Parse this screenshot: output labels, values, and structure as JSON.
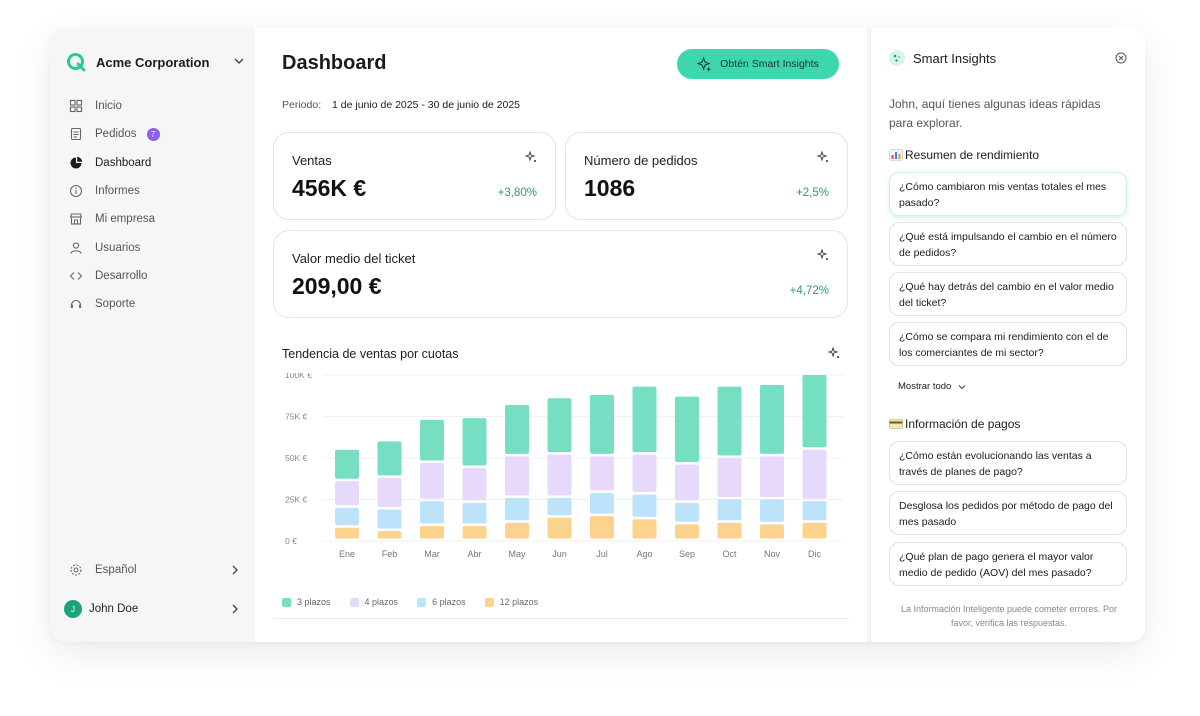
{
  "sidebar": {
    "company": "Acme Corporation",
    "items": [
      {
        "label": "Inicio",
        "icon": "grid-icon"
      },
      {
        "label": "Pedidos",
        "icon": "receipt-icon",
        "badge": "7"
      },
      {
        "label": "Dashboard",
        "icon": "pie-chart-icon",
        "active": true
      },
      {
        "label": "Informes",
        "icon": "info-icon"
      },
      {
        "label": "Mi empresa",
        "icon": "store-icon"
      },
      {
        "label": "Usuarios",
        "icon": "user-icon"
      },
      {
        "label": "Desarrollo",
        "icon": "code-icon"
      },
      {
        "label": "Soporte",
        "icon": "headset-icon"
      }
    ],
    "language": "Español",
    "user": {
      "initial": "J",
      "name": "John Doe"
    }
  },
  "main": {
    "title": "Dashboard",
    "insights_button": "Obtén Smart Insights",
    "period_label": "Periodo:",
    "period_value": "1 de junio de 2025 - 30 de junio de 2025",
    "cards": [
      {
        "label": "Ventas",
        "value": "456K €",
        "delta": "+3,80%"
      },
      {
        "label": "Número de pedidos",
        "value": "1086",
        "delta": "+2,5%"
      },
      {
        "label": "Valor medio del ticket",
        "value": "209,00 €",
        "delta": "+4,72%"
      }
    ],
    "chart_title": "Tendencia de ventas por cuotas"
  },
  "chart_data": {
    "type": "bar",
    "stacked": true,
    "categories": [
      "Ene",
      "Feb",
      "Mar",
      "Abr",
      "May",
      "Jun",
      "Jul",
      "Ago",
      "Sep",
      "Oct",
      "Nov",
      "Dic"
    ],
    "ylim": [
      0,
      100
    ],
    "yticks": [
      "0 €",
      "25K €",
      "50K €",
      "75K €",
      "100K €"
    ],
    "series": [
      {
        "name": "12 plazos",
        "color": "#fbd38d",
        "values": [
          8,
          6,
          9,
          9,
          11,
          14,
          15,
          13,
          10,
          11,
          10,
          11
        ]
      },
      {
        "name": "6 plazos",
        "color": "#bde3fb",
        "values": [
          12,
          13,
          15,
          14,
          15,
          12,
          14,
          15,
          13,
          14,
          15,
          13
        ]
      },
      {
        "name": "4 plazos",
        "color": "#e6d9fb",
        "values": [
          16,
          19,
          23,
          21,
          25,
          26,
          22,
          24,
          23,
          25,
          26,
          31
        ]
      },
      {
        "name": "3 plazos",
        "color": "#76dfc3",
        "values": [
          19,
          22,
          26,
          30,
          31,
          34,
          37,
          41,
          41,
          43,
          43,
          45
        ]
      }
    ],
    "grid": true
  },
  "panel": {
    "title": "Smart Insights",
    "intro": "John, aquí tienes algunas ideas rápidas para explorar.",
    "sections": [
      {
        "title": "Resumen de rendimiento",
        "questions": [
          "¿Cómo cambiaron mis ventas totales el mes pasado?",
          "¿Qué está impulsando el cambio en el número de pedidos?",
          "¿Qué hay detrás del cambio en el valor medio del ticket?",
          "¿Cómo se compara mi rendimiento con el de los comerciantes de mi sector?"
        ]
      },
      {
        "title": "Información de pagos",
        "questions": [
          "¿Cómo están evolucionando las ventas a través de planes de pago?",
          "Desglosa los pedidos por método de pago del mes pasado",
          "¿Qué plan de pago genera el mayor valor medio de pedido (AOV) del mes pasado?"
        ]
      }
    ],
    "show_all": "Mostrar todo",
    "disclaimer": "La Información Inteligente puede cometer errores. Por favor, verifica las respuestas."
  }
}
